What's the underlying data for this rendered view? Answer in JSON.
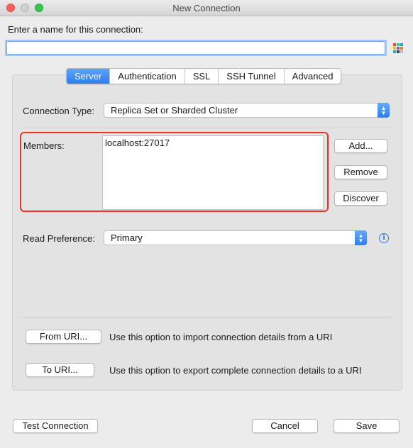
{
  "window": {
    "title": "New Connection"
  },
  "name_field": {
    "label": "Enter a name for this connection:",
    "value": ""
  },
  "tabs": [
    {
      "label": "Server",
      "active": true
    },
    {
      "label": "Authentication",
      "active": false
    },
    {
      "label": "SSL",
      "active": false
    },
    {
      "label": "SSH Tunnel",
      "active": false
    },
    {
      "label": "Advanced",
      "active": false
    }
  ],
  "server": {
    "connection_type_label": "Connection Type:",
    "connection_type_value": "Replica Set or Sharded Cluster",
    "members_label": "Members:",
    "members_value": "localhost:27017",
    "add_button": "Add...",
    "remove_button": "Remove",
    "discover_button": "Discover",
    "read_pref_label": "Read Preference:",
    "read_pref_value": "Primary"
  },
  "uri": {
    "from_button": "From URI...",
    "from_desc": "Use this option to import connection details from a URI",
    "to_button": "To URI...",
    "to_desc": "Use this option to export complete connection details to a URI"
  },
  "footer": {
    "test_button": "Test Connection",
    "cancel_button": "Cancel",
    "save_button": "Save"
  },
  "colors": {
    "accent": "#2d7cf0",
    "highlight": "#ea3323"
  }
}
